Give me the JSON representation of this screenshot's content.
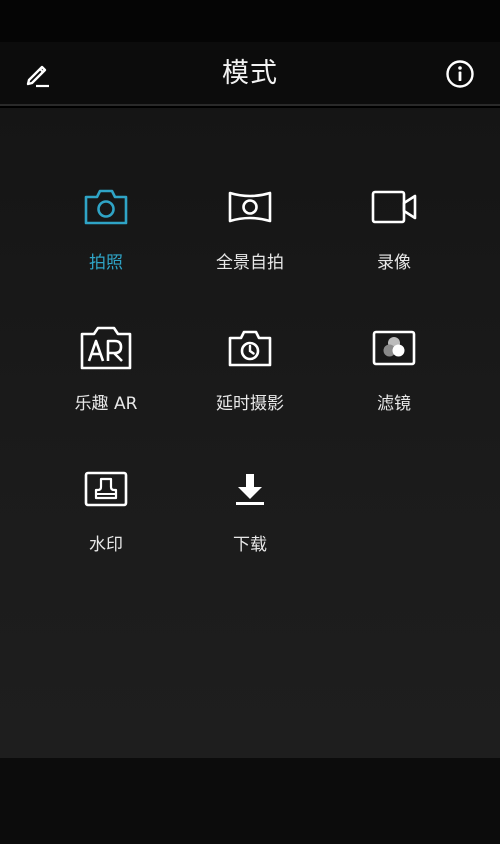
{
  "header": {
    "title": "模式",
    "left_icon": "edit-icon",
    "right_icon": "info-icon"
  },
  "modes": [
    {
      "label": "拍照",
      "icon": "camera-icon",
      "active": true
    },
    {
      "label": "全景自拍",
      "icon": "panorama-icon",
      "active": false
    },
    {
      "label": "录像",
      "icon": "video-icon",
      "active": false
    },
    {
      "label": "乐趣 AR",
      "icon": "ar-icon",
      "active": false
    },
    {
      "label": "延时摄影",
      "icon": "timelapse-icon",
      "active": false
    },
    {
      "label": "滤镜",
      "icon": "filter-icon",
      "active": false
    },
    {
      "label": "水印",
      "icon": "watermark-icon",
      "active": false
    },
    {
      "label": "下载",
      "icon": "download-icon",
      "active": false
    }
  ],
  "colors": {
    "accent": "#2fa4c6",
    "text": "#e8e8e8",
    "icon": "#ffffff",
    "background": "#1b1b1b"
  }
}
